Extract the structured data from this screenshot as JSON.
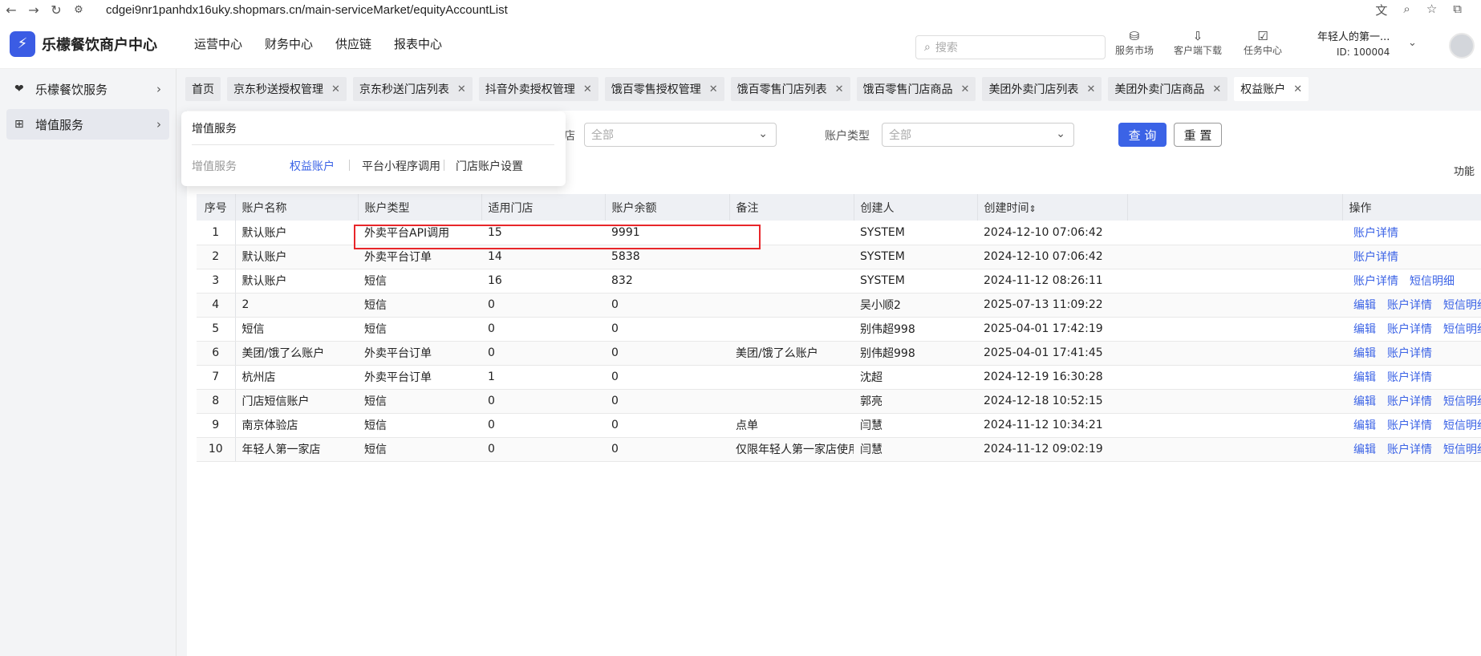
{
  "browser": {
    "url": "cdgei9nr1panhdx16uky.shopmars.cn/main-serviceMarket/equityAccountList",
    "nav": {
      "back": "←",
      "forward": "→",
      "reload": "↻",
      "site_info": "⚙"
    },
    "icons": {
      "translate": "文",
      "zoom": "⌕",
      "star": "☆",
      "extension": "⧉"
    }
  },
  "header": {
    "logo_text": "乐檬餐饮商户中心",
    "menus": [
      "运营中心",
      "财务中心",
      "供应链",
      "报表中心"
    ],
    "search_placeholder": "搜索",
    "quick": [
      {
        "label": "服务市场",
        "icon": "bag-icon"
      },
      {
        "label": "客户端下载",
        "icon": "download-icon"
      },
      {
        "label": "任务中心",
        "icon": "clipboard-icon"
      }
    ],
    "user_name": "年轻人的第一...",
    "user_id": "ID: 100004"
  },
  "sidebar": {
    "items": [
      {
        "label": "乐檬餐饮服务",
        "icon": "service-icon",
        "active": false
      },
      {
        "label": "增值服务",
        "icon": "grid-icon",
        "active": true
      }
    ]
  },
  "tabs": [
    {
      "label": "首页",
      "closable": false
    },
    {
      "label": "京东秒送授权管理",
      "closable": true
    },
    {
      "label": "京东秒送门店列表",
      "closable": true
    },
    {
      "label": "抖音外卖授权管理",
      "closable": true
    },
    {
      "label": "饿百零售授权管理",
      "closable": true
    },
    {
      "label": "饿百零售门店列表",
      "closable": true
    },
    {
      "label": "饿百零售门店商品",
      "closable": true
    },
    {
      "label": "美团外卖门店列表",
      "closable": true
    },
    {
      "label": "美团外卖门店商品",
      "closable": true
    },
    {
      "label": "权益账户",
      "closable": true,
      "active": true
    }
  ],
  "filters": {
    "store_label_partial": "店",
    "store_value": "全部",
    "type_label": "账户类型",
    "type_value": "全部",
    "query_label": "查 询",
    "reset_label": "重 置",
    "funcs_partial": "功能"
  },
  "dropdown": {
    "title": "增值服务",
    "group_label": "增值服务",
    "links": [
      "权益账户",
      "平台小程序调用",
      "门店账户设置"
    ]
  },
  "table": {
    "columns": [
      "序号",
      "账户名称",
      "账户类型",
      "适用门店",
      "账户余额",
      "备注",
      "创建人",
      "创建时间",
      "",
      "操作"
    ],
    "sort_icon": "⇕",
    "rows": [
      {
        "no": "1",
        "name": "默认账户",
        "type": "外卖平台API调用",
        "stores": "15",
        "balance": "9991",
        "remark": "",
        "creator": "SYSTEM",
        "time": "2024-12-10 07:06:42",
        "ops": [
          "账户详情"
        ]
      },
      {
        "no": "2",
        "name": "默认账户",
        "type": "外卖平台订单",
        "stores": "14",
        "balance": "5838",
        "remark": "",
        "creator": "SYSTEM",
        "time": "2024-12-10 07:06:42",
        "ops": [
          "账户详情"
        ]
      },
      {
        "no": "3",
        "name": "默认账户",
        "type": "短信",
        "stores": "16",
        "balance": "832",
        "remark": "",
        "creator": "SYSTEM",
        "time": "2024-11-12 08:26:11",
        "ops": [
          "账户详情",
          "短信明细"
        ]
      },
      {
        "no": "4",
        "name": "2",
        "type": "短信",
        "stores": "0",
        "balance": "0",
        "remark": "",
        "creator": "吴小顺2",
        "time": "2025-07-13 11:09:22",
        "ops": [
          "编辑",
          "账户详情",
          "短信明细"
        ]
      },
      {
        "no": "5",
        "name": "短信",
        "type": "短信",
        "stores": "0",
        "balance": "0",
        "remark": "",
        "creator": "别伟超998",
        "time": "2025-04-01 17:42:19",
        "ops": [
          "编辑",
          "账户详情",
          "短信明细"
        ]
      },
      {
        "no": "6",
        "name": "美团/饿了么账户",
        "type": "外卖平台订单",
        "stores": "0",
        "balance": "0",
        "remark": "美团/饿了么账户",
        "creator": "别伟超998",
        "time": "2025-04-01 17:41:45",
        "ops": [
          "编辑",
          "账户详情"
        ]
      },
      {
        "no": "7",
        "name": "杭州店",
        "type": "外卖平台订单",
        "stores": "1",
        "balance": "0",
        "remark": "",
        "creator": "沈超",
        "time": "2024-12-19 16:30:28",
        "ops": [
          "编辑",
          "账户详情"
        ]
      },
      {
        "no": "8",
        "name": "门店短信账户",
        "type": "短信",
        "stores": "0",
        "balance": "0",
        "remark": "",
        "creator": "郭亮",
        "time": "2024-12-18 10:52:15",
        "ops": [
          "编辑",
          "账户详情",
          "短信明细"
        ]
      },
      {
        "no": "9",
        "name": "南京体验店",
        "type": "短信",
        "stores": "0",
        "balance": "0",
        "remark": "点单",
        "creator": "闫慧",
        "time": "2024-11-12 10:34:21",
        "ops": [
          "编辑",
          "账户详情",
          "短信明细"
        ]
      },
      {
        "no": "10",
        "name": "年轻人第一家店",
        "type": "短信",
        "stores": "0",
        "balance": "0",
        "remark": "仅限年轻人第一家店使用",
        "creator": "闫慧",
        "time": "2024-11-12 09:02:19",
        "ops": [
          "编辑",
          "账户详情",
          "短信明细"
        ]
      }
    ]
  },
  "colors": {
    "accent": "#3b63e6",
    "highlight": "#e8262a"
  }
}
